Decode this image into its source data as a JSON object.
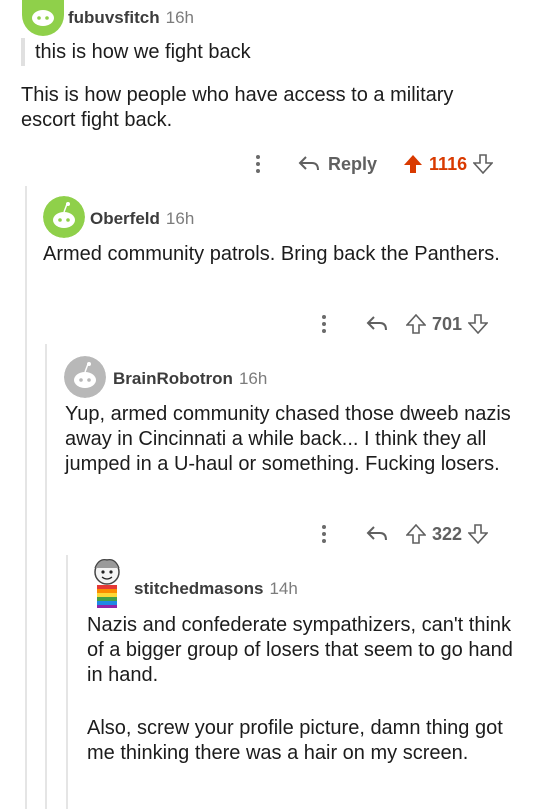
{
  "colors": {
    "accent_upvote": "#d93a00",
    "thread_line": "#e5e5e5",
    "snoo_green": "#8fd04a"
  },
  "comments": [
    {
      "username": "fubuvsfitch",
      "time": "16h",
      "quote": "this is how we fight back",
      "body": "This is how people who have access to a military escort fight back.",
      "reply_label": "Reply",
      "score": "1116",
      "avatar_icon": "snoo-avatar-icon"
    },
    {
      "username": "Oberfeld",
      "time": "16h",
      "body": "Armed community patrols. Bring back the Panthers.",
      "score": "701",
      "avatar_icon": "snoo-avatar-icon"
    },
    {
      "username": "BrainRobotron",
      "time": "16h",
      "body": "Yup, armed community chased those dweeb nazis away in Cincinnati a while back... I think they all jumped in a U-haul or something. Fucking losers.",
      "score": "322",
      "avatar_icon": "snoo-avatar-icon"
    },
    {
      "username": "stitchedmasons",
      "time": "14h",
      "body_p1": "Nazis and confederate sympathizers, can't think of a bigger group of losers that seem to go hand in hand.",
      "body_p2": "Also, screw your profile picture, damn thing got me thinking there was a hair on my screen.",
      "avatar_icon": "custom-avatar-icon"
    }
  ]
}
